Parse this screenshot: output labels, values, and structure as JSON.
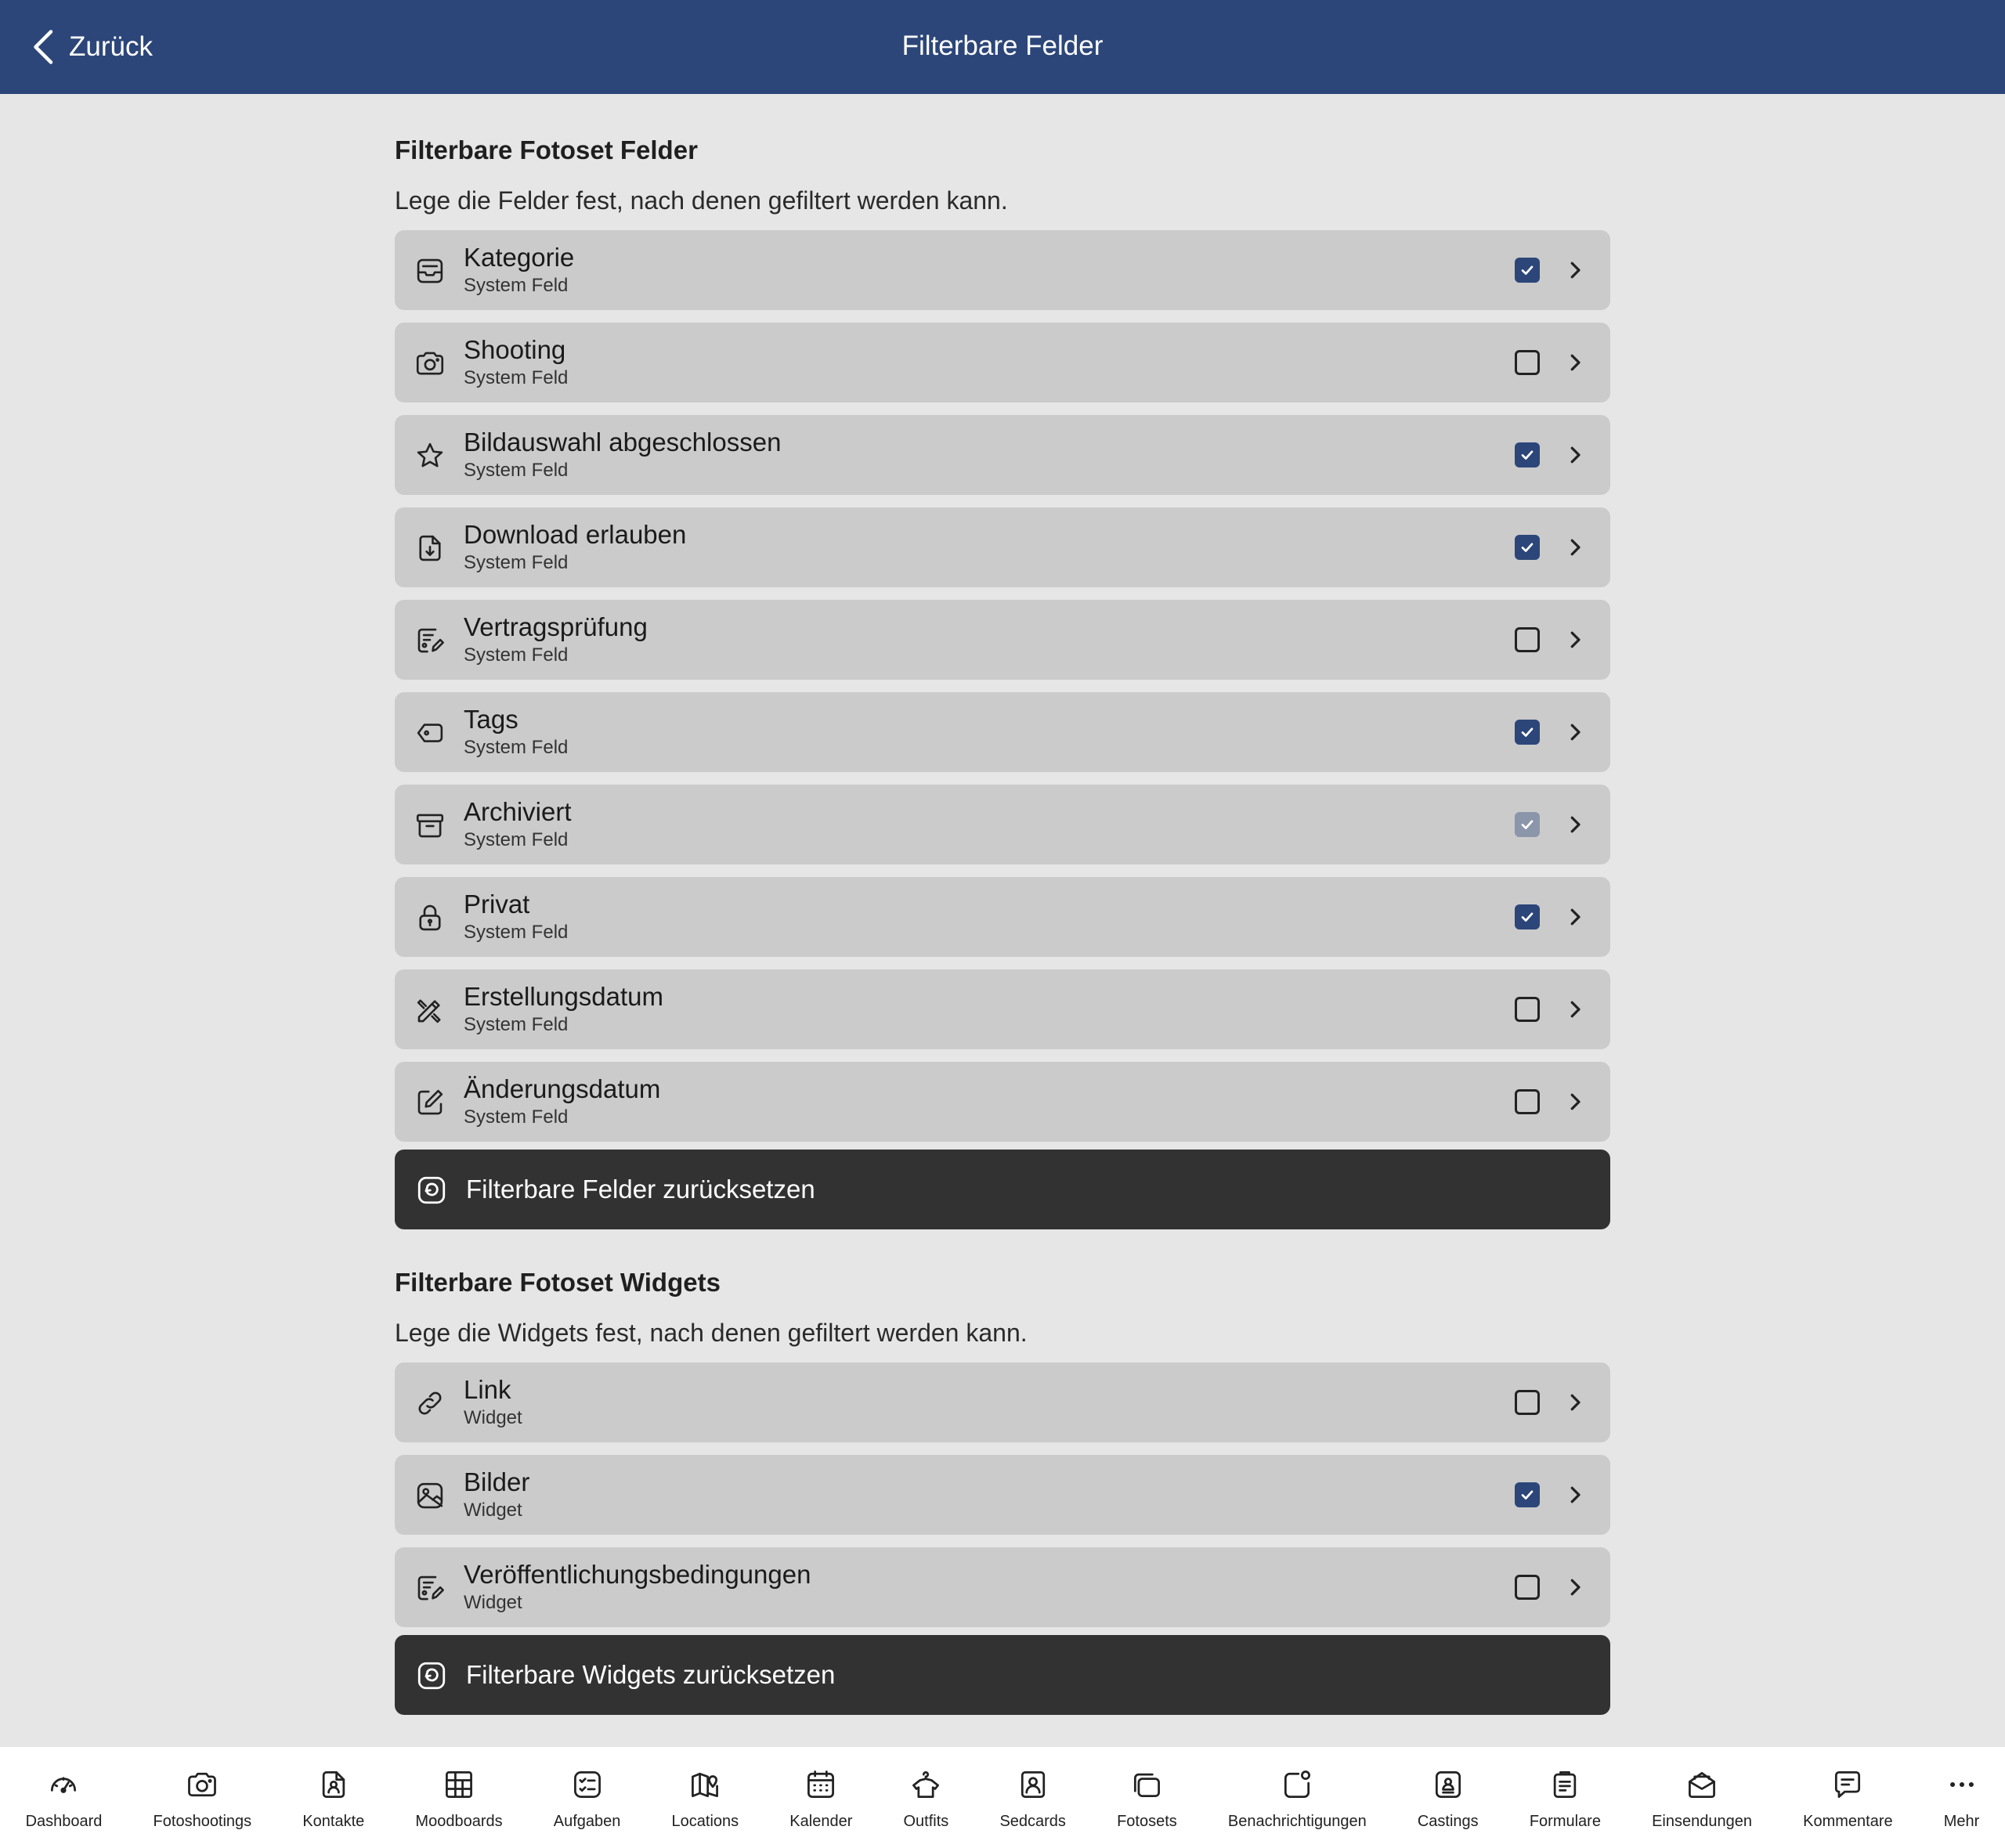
{
  "header": {
    "back_label": "Zurück",
    "title": "Filterbare Felder"
  },
  "fields_section": {
    "title": "Filterbare Fotoset Felder",
    "description": "Lege die Felder fest, nach denen gefiltert werden kann.",
    "items": [
      {
        "label": "Kategorie",
        "sub": "System Feld",
        "icon": "inbox-tray-icon",
        "state": "checked"
      },
      {
        "label": "Shooting",
        "sub": "System Feld",
        "icon": "camera-icon",
        "state": "unchecked"
      },
      {
        "label": "Bildauswahl abgeschlossen",
        "sub": "System Feld",
        "icon": "star-icon",
        "state": "checked"
      },
      {
        "label": "Download erlauben",
        "sub": "System Feld",
        "icon": "file-download-icon",
        "state": "checked"
      },
      {
        "label": "Vertragsprüfung",
        "sub": "System Feld",
        "icon": "contract-edit-icon",
        "state": "unchecked"
      },
      {
        "label": "Tags",
        "sub": "System Feld",
        "icon": "tag-icon",
        "state": "checked"
      },
      {
        "label": "Archiviert",
        "sub": "System Feld",
        "icon": "archive-box-icon",
        "state": "checked-disabled"
      },
      {
        "label": "Privat",
        "sub": "System Feld",
        "icon": "lock-icon",
        "state": "checked"
      },
      {
        "label": "Erstellungsdatum",
        "sub": "System Feld",
        "icon": "pencil-ruler-icon",
        "state": "unchecked"
      },
      {
        "label": "Änderungsdatum",
        "sub": "System Feld",
        "icon": "edit-square-icon",
        "state": "unchecked"
      }
    ],
    "reset_label": "Filterbare Felder zurücksetzen"
  },
  "widgets_section": {
    "title": "Filterbare Fotoset Widgets",
    "description": "Lege die Widgets fest, nach denen gefiltert werden kann.",
    "items": [
      {
        "label": "Link",
        "sub": "Widget",
        "icon": "link-icon",
        "state": "unchecked"
      },
      {
        "label": "Bilder",
        "sub": "Widget",
        "icon": "image-icon",
        "state": "checked"
      },
      {
        "label": "Veröffentlichungsbedingungen",
        "sub": "Widget",
        "icon": "contract-edit-icon",
        "state": "unchecked"
      }
    ],
    "reset_label": "Filterbare Widgets zurücksetzen"
  },
  "tabbar": [
    {
      "label": "Dashboard",
      "icon": "speedometer-icon"
    },
    {
      "label": "Fotoshootings",
      "icon": "camera-icon"
    },
    {
      "label": "Kontakte",
      "icon": "contact-card-icon"
    },
    {
      "label": "Moodboards",
      "icon": "grid-board-icon"
    },
    {
      "label": "Aufgaben",
      "icon": "task-list-icon"
    },
    {
      "label": "Locations",
      "icon": "map-pin-icon"
    },
    {
      "label": "Kalender",
      "icon": "calendar-icon"
    },
    {
      "label": "Outfits",
      "icon": "hanger-shirt-icon"
    },
    {
      "label": "Sedcards",
      "icon": "portrait-card-icon"
    },
    {
      "label": "Fotosets",
      "icon": "photo-stack-icon"
    },
    {
      "label": "Benachrichtigungen",
      "icon": "notification-badge-icon"
    },
    {
      "label": "Castings",
      "icon": "id-badge-icon"
    },
    {
      "label": "Formulare",
      "icon": "clipboard-form-icon"
    },
    {
      "label": "Einsendungen",
      "icon": "envelope-open-icon"
    },
    {
      "label": "Kommentare",
      "icon": "comment-icon"
    },
    {
      "label": "Mehr",
      "icon": "more-dots-icon"
    }
  ]
}
